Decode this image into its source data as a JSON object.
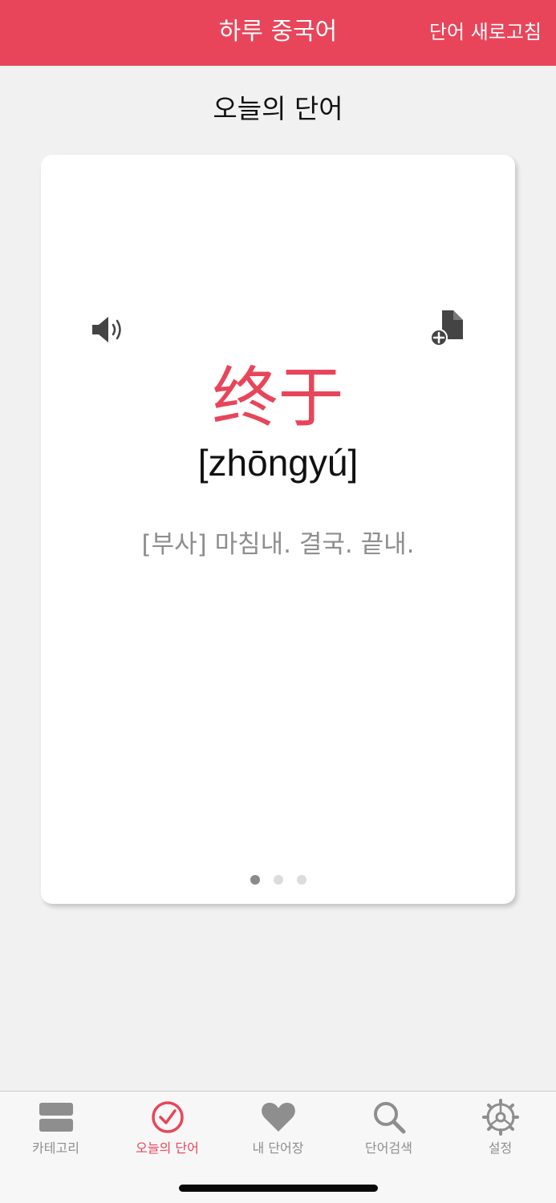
{
  "header": {
    "title": "하루 중국어",
    "refresh_label": "단어 새로고침",
    "accent_color": "#e8455b"
  },
  "page": {
    "title": "오늘의 단어"
  },
  "word_card": {
    "hanzi": "终于",
    "pinyin": "[zhōngyú]",
    "meaning": "[부사] 마침내. 결국. 끝내.",
    "speaker_icon": "speaker-icon",
    "add_icon": "add-to-wordbook-icon",
    "pager": {
      "current_page": 1,
      "total_pages": 3
    }
  },
  "tab_bar": {
    "items": [
      {
        "label": "카테고리",
        "icon": "category-icon",
        "active": false
      },
      {
        "label": "오늘의 단어",
        "icon": "check-circle-icon",
        "active": true
      },
      {
        "label": "내 단어장",
        "icon": "heart-icon",
        "active": false
      },
      {
        "label": "단어검색",
        "icon": "search-icon",
        "active": false
      },
      {
        "label": "설정",
        "icon": "gear-icon",
        "active": false
      }
    ]
  }
}
